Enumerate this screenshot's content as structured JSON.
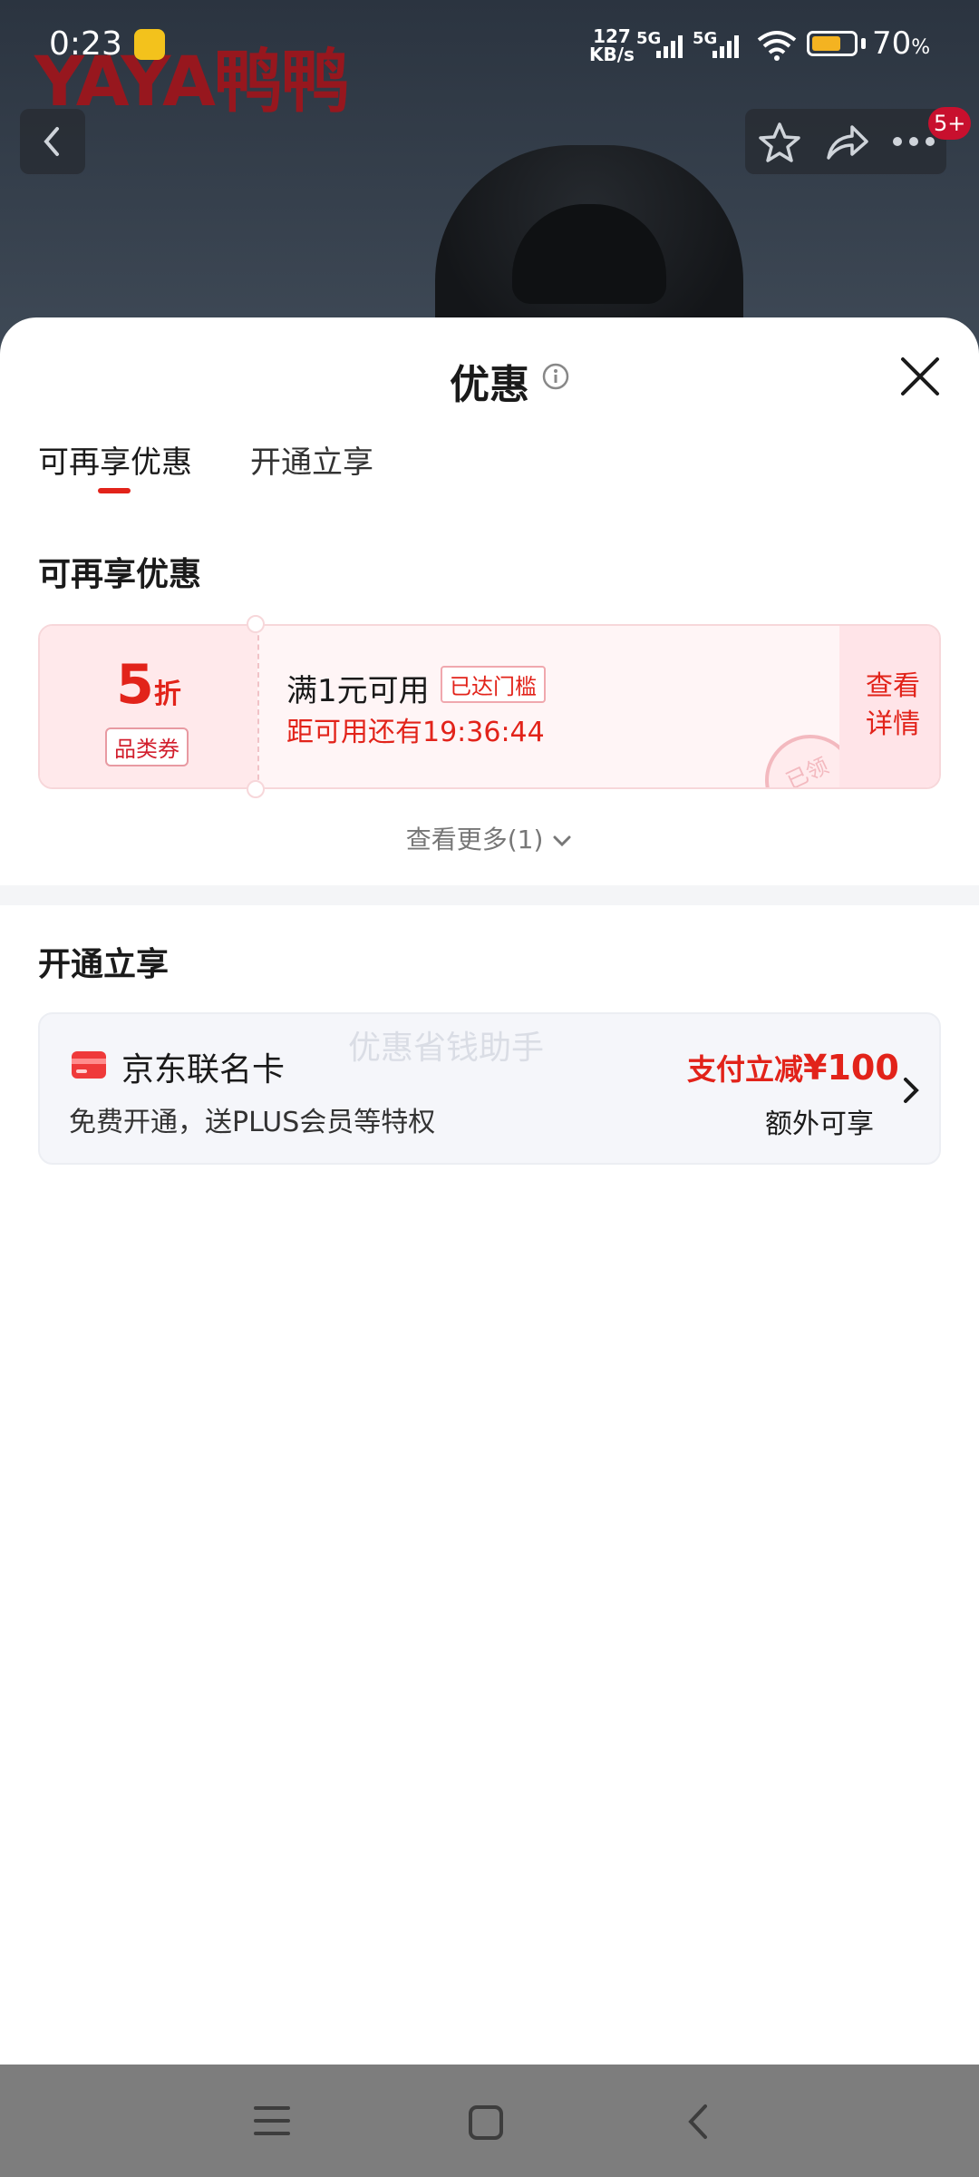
{
  "status_bar": {
    "time": "0:23",
    "net_speed_top": "127",
    "net_speed_bottom": "KB/s",
    "sim1": "5G",
    "sim2": "5G",
    "battery": "70",
    "battery_unit": "%",
    "battery_level": 0.7
  },
  "background": {
    "logo_text": "YAYA鸭鸭"
  },
  "nav": {
    "notification_badge": "5+"
  },
  "sheet": {
    "title": "优惠",
    "tabs": [
      {
        "label": "可再享优惠",
        "active": true
      },
      {
        "label": "开通立享",
        "active": false
      }
    ],
    "section1_heading": "可再享优惠",
    "coupon": {
      "discount_number": "5",
      "discount_unit": "折",
      "type_label": "品类券",
      "condition": "满1元可用",
      "reached_tag": "已达门槛",
      "countdown": "距可用还有19:36:44",
      "detail_button": "查看详情",
      "stamp_text": "已领"
    },
    "more_link": "查看更多(1)",
    "section2_heading": "开通立享",
    "card": {
      "title": "京东联名卡",
      "subtitle": "免费开通，送PLUS会员等特权",
      "promo_prefix": "支付立减",
      "promo_amount": "¥100",
      "extra": "额外可享",
      "watermark": "优惠省钱助手"
    }
  },
  "colors": {
    "accent_red": "#e2231a",
    "battery_yellow": "#f4b321"
  }
}
